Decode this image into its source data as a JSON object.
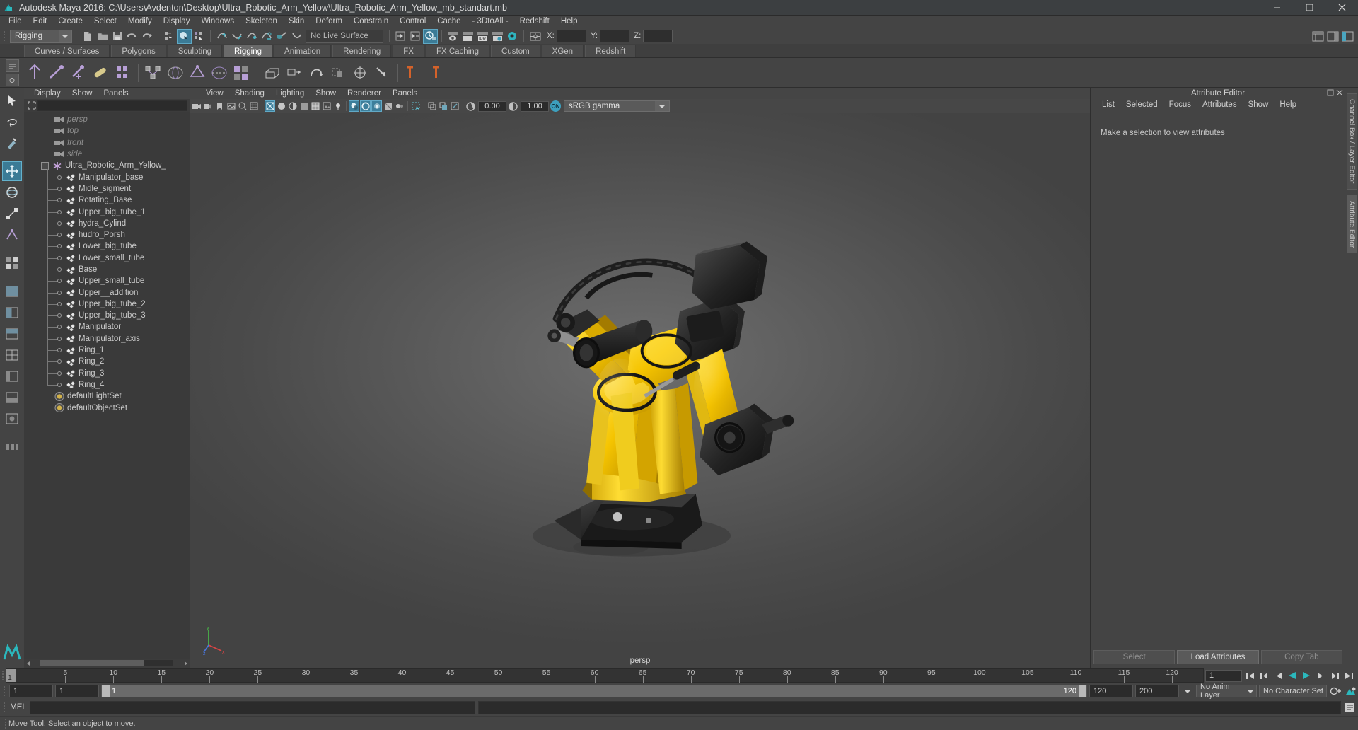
{
  "window": {
    "title": "Autodesk Maya 2016: C:\\Users\\Avdenton\\Desktop\\Ultra_Robotic_Arm_Yellow\\Ultra_Robotic_Arm_Yellow_mb_standart.mb",
    "minimize_label": "Minimize",
    "maximize_label": "Maximize",
    "close_label": "Close"
  },
  "menubar": {
    "items": [
      "File",
      "Edit",
      "Create",
      "Select",
      "Modify",
      "Display",
      "Windows",
      "Skeleton",
      "Skin",
      "Deform",
      "Constrain",
      "Control",
      "Cache",
      "- 3DtoAll -",
      "Redshift",
      "Help"
    ]
  },
  "statusbar": {
    "mode": "Rigging",
    "live_surface": "No Live Surface",
    "coord_x_label": "X:",
    "coord_y_label": "Y:",
    "coord_z_label": "Z:",
    "coord_x_value": "",
    "coord_y_value": "",
    "coord_z_value": "",
    "icons": [
      "new-scene-icon",
      "open-scene-icon",
      "save-scene-icon",
      "undo-icon",
      "redo-icon",
      "select-hierarchy-icon",
      "select-object-icon",
      "select-component-icon",
      "snap-grid-icon",
      "snap-curve-icon",
      "snap-point-icon",
      "snap-projected-icon",
      "snap-view-plane-icon",
      "make-live-icon",
      "show-manipulator-icon",
      "input-connections-icon",
      "output-connections-icon",
      "construction-history-icon",
      "render-view-icon",
      "render-sequence-icon",
      "ipr-render-icon",
      "render-settings-icon",
      "hypershade-icon",
      "editor-layout-icon"
    ]
  },
  "shelf": {
    "tabs": [
      "Curves / Surfaces",
      "Polygons",
      "Sculpting",
      "Rigging",
      "Animation",
      "Rendering",
      "FX",
      "FX Caching",
      "Custom",
      "XGen",
      "Redshift"
    ],
    "active_tab": "Rigging",
    "buttons": [
      "create-joint-icon",
      "ik-handle-icon",
      "ik-spline-handle-icon",
      "insert-joint-icon",
      "joint-tool-icon",
      "bind-skin-icon",
      "interactive-bind-icon",
      "smooth-bind-icon",
      "detach-skin-icon",
      "paint-skin-weights-icon",
      "lattice-icon",
      "cluster-icon",
      "wrap-icon",
      "blendshape-icon",
      "parent-constraint-icon",
      "point-constraint-icon"
    ]
  },
  "toolbox": {
    "items": [
      {
        "name": "select-tool",
        "selected": false
      },
      {
        "name": "lasso-tool",
        "selected": false
      },
      {
        "name": "paint-select-tool",
        "selected": false
      },
      {
        "name": "move-tool",
        "selected": true
      },
      {
        "name": "rotate-tool",
        "selected": false
      },
      {
        "name": "scale-tool",
        "selected": false
      },
      {
        "name": "last-tool",
        "selected": false
      },
      {
        "name": "single-pane-layout",
        "selected": false
      },
      {
        "name": "two-pane-side-layout",
        "selected": false
      },
      {
        "name": "two-pane-stacked-layout",
        "selected": false
      },
      {
        "name": "four-pane-layout",
        "selected": false
      },
      {
        "name": "persp-outliner-layout",
        "selected": false
      },
      {
        "name": "persp-graph-layout",
        "selected": false
      },
      {
        "name": "hypershade-layout",
        "selected": false
      }
    ]
  },
  "outliner": {
    "menus": [
      "Display",
      "Show",
      "Panels"
    ],
    "search_value": "",
    "items": [
      {
        "label": "persp",
        "icon": "camera-icon",
        "depth": 1,
        "dim": true,
        "tree": false
      },
      {
        "label": "top",
        "icon": "camera-icon",
        "depth": 1,
        "dim": true,
        "tree": false
      },
      {
        "label": "front",
        "icon": "camera-icon",
        "depth": 1,
        "dim": true,
        "tree": false
      },
      {
        "label": "side",
        "icon": "camera-icon",
        "depth": 1,
        "dim": true,
        "tree": false
      },
      {
        "label": "Ultra_Robotic_Arm_Yellow_",
        "icon": "group-icon",
        "depth": 0,
        "dim": false,
        "tree": false,
        "expander": true
      },
      {
        "label": "Manipulator_base",
        "icon": "mesh-icon",
        "depth": 1,
        "dim": false,
        "tree": true
      },
      {
        "label": "Midle_sigment",
        "icon": "mesh-icon",
        "depth": 1,
        "dim": false,
        "tree": true
      },
      {
        "label": "Rotating_Base",
        "icon": "mesh-icon",
        "depth": 1,
        "dim": false,
        "tree": true
      },
      {
        "label": "Upper_big_tube_1",
        "icon": "mesh-icon",
        "depth": 1,
        "dim": false,
        "tree": true
      },
      {
        "label": "hydra_Cylind",
        "icon": "mesh-icon",
        "depth": 1,
        "dim": false,
        "tree": true
      },
      {
        "label": "hudro_Porsh",
        "icon": "mesh-icon",
        "depth": 1,
        "dim": false,
        "tree": true
      },
      {
        "label": "Lower_big_tube",
        "icon": "mesh-icon",
        "depth": 1,
        "dim": false,
        "tree": true
      },
      {
        "label": "Lower_small_tube",
        "icon": "mesh-icon",
        "depth": 1,
        "dim": false,
        "tree": true
      },
      {
        "label": "Base",
        "icon": "mesh-icon",
        "depth": 1,
        "dim": false,
        "tree": true
      },
      {
        "label": "Upper_small_tube",
        "icon": "mesh-icon",
        "depth": 1,
        "dim": false,
        "tree": true
      },
      {
        "label": "Upper__addition",
        "icon": "mesh-icon",
        "depth": 1,
        "dim": false,
        "tree": true
      },
      {
        "label": "Upper_big_tube_2",
        "icon": "mesh-icon",
        "depth": 1,
        "dim": false,
        "tree": true
      },
      {
        "label": "Upper_big_tube_3",
        "icon": "mesh-icon",
        "depth": 1,
        "dim": false,
        "tree": true
      },
      {
        "label": "Manipulator",
        "icon": "mesh-icon",
        "depth": 1,
        "dim": false,
        "tree": true
      },
      {
        "label": "Manipulator_axis",
        "icon": "mesh-icon",
        "depth": 1,
        "dim": false,
        "tree": true
      },
      {
        "label": "Ring_1",
        "icon": "mesh-icon",
        "depth": 1,
        "dim": false,
        "tree": true
      },
      {
        "label": "Ring_2",
        "icon": "mesh-icon",
        "depth": 1,
        "dim": false,
        "tree": true
      },
      {
        "label": "Ring_3",
        "icon": "mesh-icon",
        "depth": 1,
        "dim": false,
        "tree": true
      },
      {
        "label": "Ring_4",
        "icon": "mesh-icon",
        "depth": 1,
        "dim": false,
        "tree": true
      },
      {
        "label": "defaultLightSet",
        "icon": "set-icon",
        "depth": 1,
        "dim": false,
        "tree": false
      },
      {
        "label": "defaultObjectSet",
        "icon": "set-icon",
        "depth": 1,
        "dim": false,
        "tree": false
      }
    ]
  },
  "viewport": {
    "menus": [
      "View",
      "Shading",
      "Lighting",
      "Show",
      "Renderer",
      "Panels"
    ],
    "camera_label": "persp",
    "exposure_value": "0.00",
    "gamma_value": "1.00",
    "color_space": "sRGB gamma",
    "color_management_enabled": "ON",
    "toolbar_icons": [
      "select-camera-icon",
      "camera-attributes-icon",
      "bookmarks-icon",
      "image-plane-icon",
      "two-d-pan-zoom-icon",
      "grid-toggle-icon",
      "wireframe-icon",
      "smooth-shade-all-icon",
      "smooth-shade-selected-icon",
      "flat-shade-icon",
      "shaded-wireframe-icon",
      "textured-icon",
      "lights-icon",
      "shadows-icon",
      "screen-space-ao-icon",
      "motion-blur-icon",
      "multisample-icon",
      "depth-of-field-icon",
      "isolate-select-icon",
      "xray-icon",
      "xray-joints-icon",
      "xray-active-components-icon",
      "exposure-icon",
      "gamma-icon",
      "color-management-icon"
    ]
  },
  "attribute_editor": {
    "title": "Attribute Editor",
    "menus": [
      "List",
      "Selected",
      "Focus",
      "Attributes",
      "Show",
      "Help"
    ],
    "message": "Make a selection to view attributes",
    "buttons": [
      {
        "label": "Select",
        "enabled": false
      },
      {
        "label": "Load Attributes",
        "enabled": true
      },
      {
        "label": "Copy Tab",
        "enabled": false
      }
    ]
  },
  "right_rail": {
    "tabs": [
      "Channel Box / Layer Editor",
      "Attribute Editor"
    ]
  },
  "timeline": {
    "tick_labels": [
      "5",
      "10",
      "15",
      "20",
      "25",
      "30",
      "35",
      "40",
      "45",
      "50",
      "55",
      "60",
      "65",
      "70",
      "75",
      "80",
      "85",
      "90",
      "95",
      "100",
      "105",
      "110",
      "115",
      "120"
    ],
    "tick_values": [
      5,
      10,
      15,
      20,
      25,
      30,
      35,
      40,
      45,
      50,
      55,
      60,
      65,
      70,
      75,
      80,
      85,
      90,
      95,
      100,
      105,
      110,
      115,
      120
    ],
    "current_frame": "1",
    "range_min": 1,
    "range_max": 120,
    "playback_field": "1",
    "transport_icons": [
      "go-to-start-icon",
      "step-back-key-icon",
      "step-back-frame-icon",
      "play-backwards-icon",
      "play-forwards-icon",
      "step-forward-frame-icon",
      "step-forward-key-icon",
      "go-to-end-icon"
    ]
  },
  "range_slider": {
    "start_field": "1",
    "start_field2": "1",
    "bar_start_label": "1",
    "bar_end_label": "120",
    "end_field": "120",
    "playback_end_field": "200",
    "anim_layer": "No Anim Layer",
    "character_set": "No Character Set",
    "auto_key_icon": "auto-key-icon",
    "anim_prefs_icon": "animation-preferences-icon"
  },
  "command_line": {
    "language_label": "MEL",
    "input_value": "",
    "output_value": "",
    "script_editor_icon": "script-editor-icon"
  },
  "helpline": {
    "text": "Move Tool: Select an object to move."
  },
  "colors": {
    "accent_blue": "#3b7b96",
    "accent_cyan": "#2bb8bd",
    "panel_bg": "#444444",
    "outliner_bg": "#3a3a3a",
    "robot_yellow": "#f2c400"
  }
}
